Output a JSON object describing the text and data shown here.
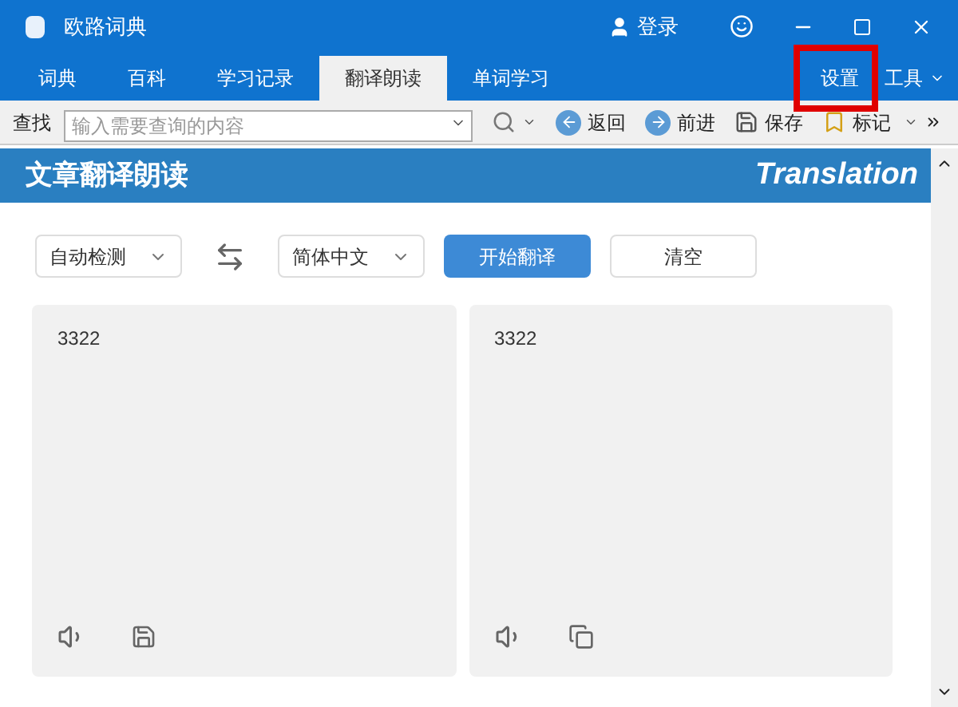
{
  "window": {
    "title": "欧路词典",
    "login": "登录"
  },
  "tabs": [
    {
      "label": "词典",
      "selected": false
    },
    {
      "label": "百科",
      "selected": false
    },
    {
      "label": "学习记录",
      "selected": false
    },
    {
      "label": "翻译朗读",
      "selected": true
    },
    {
      "label": "单词学习",
      "selected": false
    }
  ],
  "menu_right": [
    {
      "label": "设置",
      "kind": "plain"
    },
    {
      "label": "工具",
      "kind": "dropdown"
    }
  ],
  "toolbar": {
    "search_label": "查找",
    "search": {
      "placeholder": "输入需要查询的内容"
    },
    "buttons": [
      {
        "label": "返回",
        "kind": "back"
      },
      {
        "label": "前进",
        "kind": "forward"
      },
      {
        "label": "保存",
        "kind": "save"
      },
      {
        "label": "标记",
        "kind": "mark"
      }
    ]
  },
  "banner": {
    "title": "文章翻译朗读",
    "subtitle": "Translation"
  },
  "controls": {
    "source_language": "自动检测",
    "target_language": "简体中文",
    "translate": "开始翻译",
    "clear": "清空"
  },
  "panels": [
    {
      "text": "3322",
      "kind": "input"
    },
    {
      "text": "3322",
      "kind": "output"
    }
  ]
}
